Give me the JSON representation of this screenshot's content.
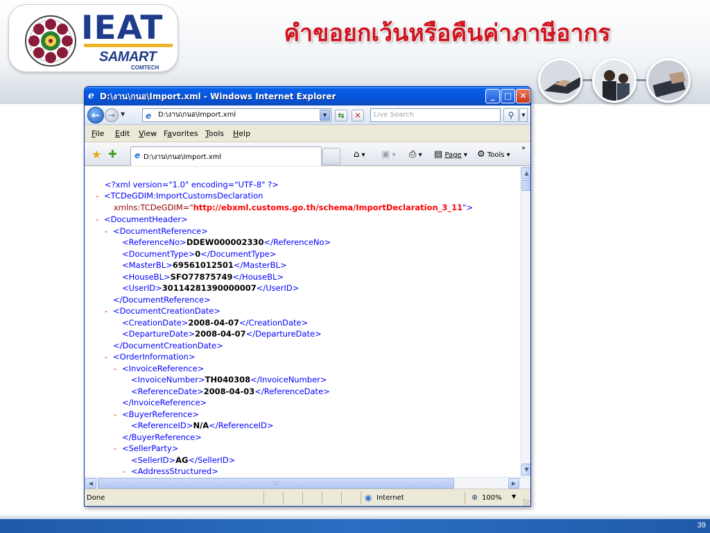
{
  "slide": {
    "logo": {
      "text": "IEAT",
      "subbrand": "SAMART",
      "subtext": "COMTECH"
    },
    "title": "คำขอยกเว้นหรือคืนค่าภาษีอากร",
    "page_number": "39",
    "colors": {
      "title": "#d0131e",
      "brand_blue": "#1e3c8c",
      "footer_blue": "#1f5aa8"
    }
  },
  "window": {
    "title": "D:\\งาน\\กนอ\\Import.xml - Windows Internet Explorer",
    "icons": {
      "ie": "ie-logo-icon",
      "minimize": "minimize-icon",
      "maximize": "maximize-icon",
      "close": "close-icon"
    },
    "address": "D:\\งาน\\กนอ\\Import.xml",
    "search_placeholder": "Live Search",
    "menu": [
      "File",
      "Edit",
      "View",
      "Favorites",
      "Tools",
      "Help"
    ],
    "menu_underline": [
      "F",
      "E",
      "V",
      "a",
      "T",
      "H"
    ],
    "tab_label": "D:\\งาน\\กนอ\\Import.xml",
    "commands": {
      "page": "Page",
      "tools": "Tools",
      "more": "»"
    },
    "status": {
      "text": "Done",
      "zone": "Internet",
      "zoom": "100%"
    }
  },
  "xml": {
    "decl": "<?xml version=\"1.0\" encoding=\"UTF-8\" ?>",
    "root_open": "<TCDeGDIM:ImportCustomsDeclaration",
    "root_attr": "xmlns:TCDeGDIM=\"",
    "root_url": "http://ebxml.customs.go.th/schema/ImportDeclaration_3_11",
    "root_attr_end": "\">",
    "lines": [
      {
        "depth": 1,
        "minus": true,
        "open": "<DocumentHeader>"
      },
      {
        "depth": 2,
        "minus": true,
        "open": "<DocumentReference>"
      },
      {
        "depth": 3,
        "open": "<ReferenceNo>",
        "value": "DDEW000002330",
        "close": "</ReferenceNo>"
      },
      {
        "depth": 3,
        "open": "<DocumentType>",
        "value": "0",
        "close": "</DocumentType>"
      },
      {
        "depth": 3,
        "open": "<MasterBL>",
        "value": "69561012501",
        "close": "</MasterBL>"
      },
      {
        "depth": 3,
        "open": "<HouseBL>",
        "value": "SFO77875749",
        "close": "</HouseBL>"
      },
      {
        "depth": 3,
        "open": "<UserID>",
        "value": "30114281390000007",
        "close": "</UserID>"
      },
      {
        "depth": 2,
        "open": "</DocumentReference>"
      },
      {
        "depth": 2,
        "minus": true,
        "open": "<DocumentCreationDate>"
      },
      {
        "depth": 3,
        "open": "<CreationDate>",
        "value": "2008-04-07",
        "close": "</CreationDate>"
      },
      {
        "depth": 3,
        "open": "<DepartureDate>",
        "value": "2008-04-07",
        "close": "</DepartureDate>"
      },
      {
        "depth": 2,
        "open": "</DocumentCreationDate>"
      },
      {
        "depth": 2,
        "minus": true,
        "open": "<OrderInformation>"
      },
      {
        "depth": 3,
        "minus": true,
        "open": "<InvoiceReference>"
      },
      {
        "depth": 4,
        "open": "<InvoiceNumber>",
        "value": "TH040308",
        "close": "</InvoiceNumber>"
      },
      {
        "depth": 4,
        "open": "<ReferenceDate>",
        "value": "2008-04-03",
        "close": "</ReferenceDate>"
      },
      {
        "depth": 3,
        "open": "</InvoiceReference>"
      },
      {
        "depth": 3,
        "minus": true,
        "open": "<BuyerReference>"
      },
      {
        "depth": 4,
        "open": "<ReferenceID>",
        "value": "N/A",
        "close": "</ReferenceID>"
      },
      {
        "depth": 3,
        "open": "</BuyerReference>"
      },
      {
        "depth": 3,
        "minus": true,
        "open": "<SellerParty>"
      },
      {
        "depth": 4,
        "open": "<SellerID>",
        "value": "AG",
        "close": "</SellerID>"
      },
      {
        "depth": 4,
        "minus": true,
        "open": "<AddressStructured>"
      }
    ]
  }
}
